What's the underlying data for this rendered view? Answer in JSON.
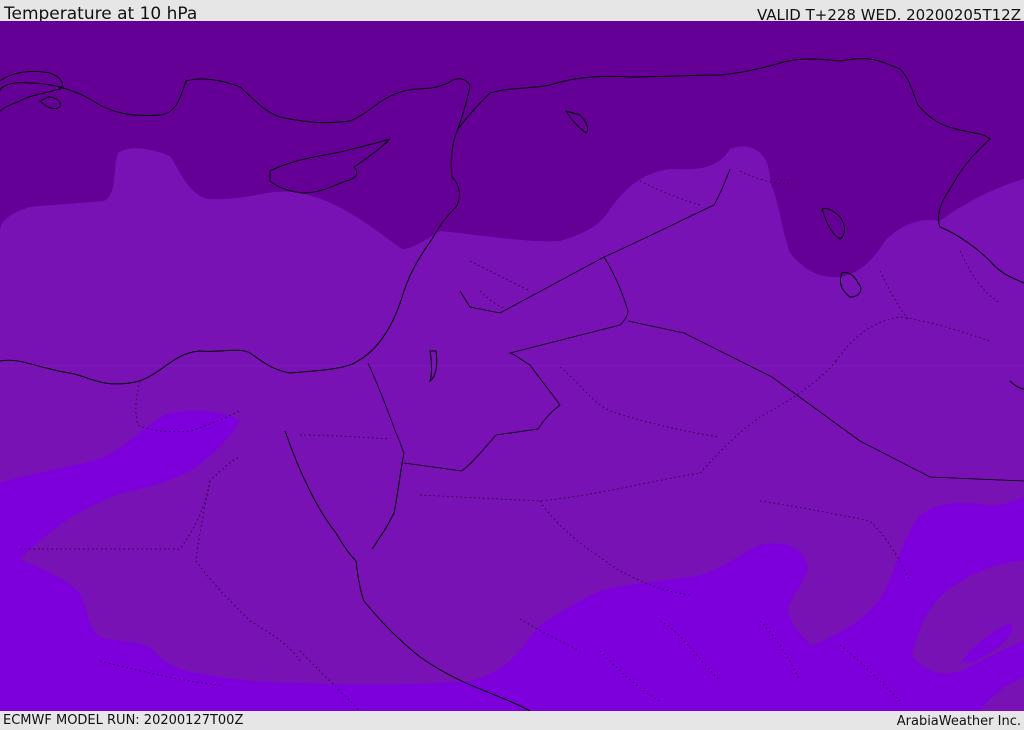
{
  "header": {
    "title": "Temperature at 10 hPa",
    "valid": "VALID T+228 WED. 20200205T12Z"
  },
  "footer": {
    "model_run": "ECMWF MODEL RUN: 20200127T00Z",
    "brand": "ArabiaWeather Inc."
  },
  "colors": {
    "band_cold": "#640096",
    "band_mid": "#7812b4",
    "band_warm": "#7d00dc",
    "coastline": "#000000",
    "bar_background": "#e6e6e6"
  }
}
